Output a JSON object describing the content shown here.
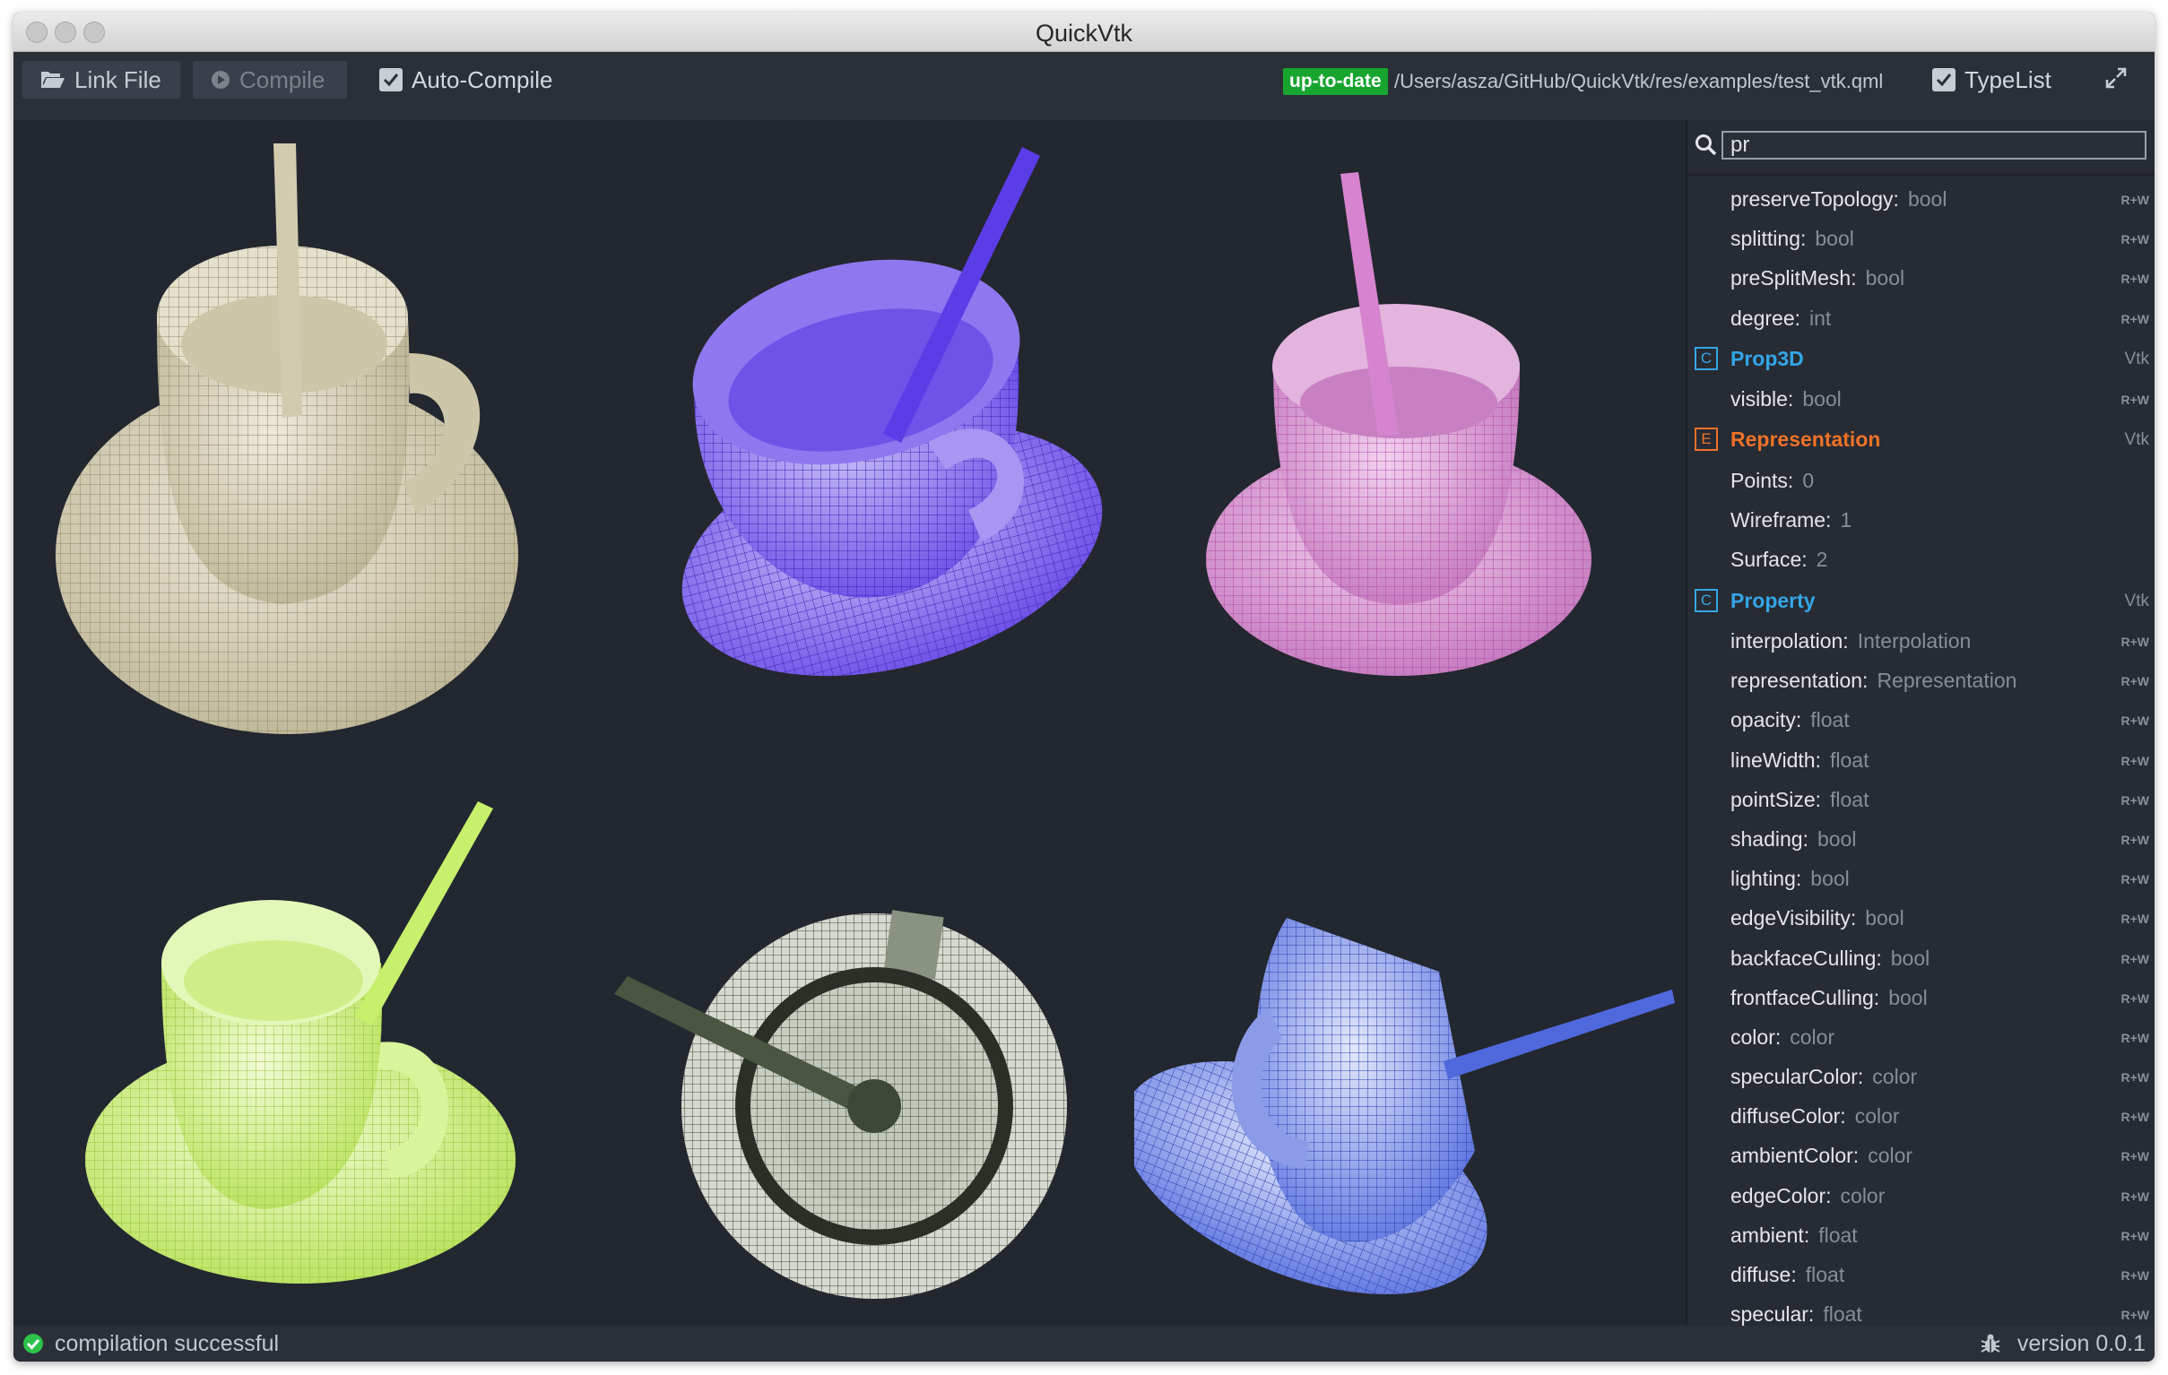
{
  "window": {
    "title": "QuickVtk"
  },
  "toolbar": {
    "link_file_label": "Link File",
    "compile_label": "Compile",
    "auto_compile_label": "Auto-Compile",
    "auto_compile_checked": true,
    "status_badge": "up-to-date",
    "status_badge_color": "#17a52f",
    "file_path": "/Users/asza/GitHub/QuickVtk/res/examples/test_vtk.qml",
    "typelist_label": "TypeList",
    "typelist_checked": true
  },
  "viewport": {
    "cup_colors": [
      "#d2cbb0",
      "#7a5cf2",
      "#d684d0",
      "#c7f06c",
      "#3e4838",
      "#4f68dc"
    ]
  },
  "type_list": {
    "search_value": "pr",
    "items": [
      {
        "name": "preserveTopology:",
        "type": "bool",
        "access": "R+W"
      },
      {
        "name": "splitting:",
        "type": "bool",
        "access": "R+W"
      },
      {
        "name": "preSplitMesh:",
        "type": "bool",
        "access": "R+W"
      },
      {
        "name": "degree:",
        "type": "int",
        "access": "R+W"
      },
      {
        "badge": "C",
        "name": "Prop3D",
        "module": "Vtk",
        "kind": "class"
      },
      {
        "name": "visible:",
        "type": "bool",
        "access": "R+W"
      },
      {
        "badge": "E",
        "name": "Representation",
        "module": "Vtk",
        "kind": "enum"
      },
      {
        "name": "Points:",
        "type": "0"
      },
      {
        "name": "Wireframe:",
        "type": "1"
      },
      {
        "name": "Surface:",
        "type": "2"
      },
      {
        "badge": "C",
        "name": "Property",
        "module": "Vtk",
        "kind": "class"
      },
      {
        "name": "interpolation:",
        "type": "Interpolation",
        "access": "R+W"
      },
      {
        "name": "representation:",
        "type": "Representation",
        "access": "R+W"
      },
      {
        "name": "opacity:",
        "type": "float",
        "access": "R+W"
      },
      {
        "name": "lineWidth:",
        "type": "float",
        "access": "R+W"
      },
      {
        "name": "pointSize:",
        "type": "float",
        "access": "R+W"
      },
      {
        "name": "shading:",
        "type": "bool",
        "access": "R+W"
      },
      {
        "name": "lighting:",
        "type": "bool",
        "access": "R+W"
      },
      {
        "name": "edgeVisibility:",
        "type": "bool",
        "access": "R+W"
      },
      {
        "name": "backfaceCulling:",
        "type": "bool",
        "access": "R+W"
      },
      {
        "name": "frontfaceCulling:",
        "type": "bool",
        "access": "R+W"
      },
      {
        "name": "color:",
        "type": "color",
        "access": "R+W"
      },
      {
        "name": "specularColor:",
        "type": "color",
        "access": "R+W"
      },
      {
        "name": "diffuseColor:",
        "type": "color",
        "access": "R+W"
      },
      {
        "name": "ambientColor:",
        "type": "color",
        "access": "R+W"
      },
      {
        "name": "edgeColor:",
        "type": "color",
        "access": "R+W"
      },
      {
        "name": "ambient:",
        "type": "float",
        "access": "R+W"
      },
      {
        "name": "diffuse:",
        "type": "float",
        "access": "R+W"
      },
      {
        "name": "specular:",
        "type": "float",
        "access": "R+W"
      }
    ]
  },
  "statusbar": {
    "message": "compilation successful",
    "version": "version 0.0.1",
    "success_color": "#2ec24a"
  }
}
